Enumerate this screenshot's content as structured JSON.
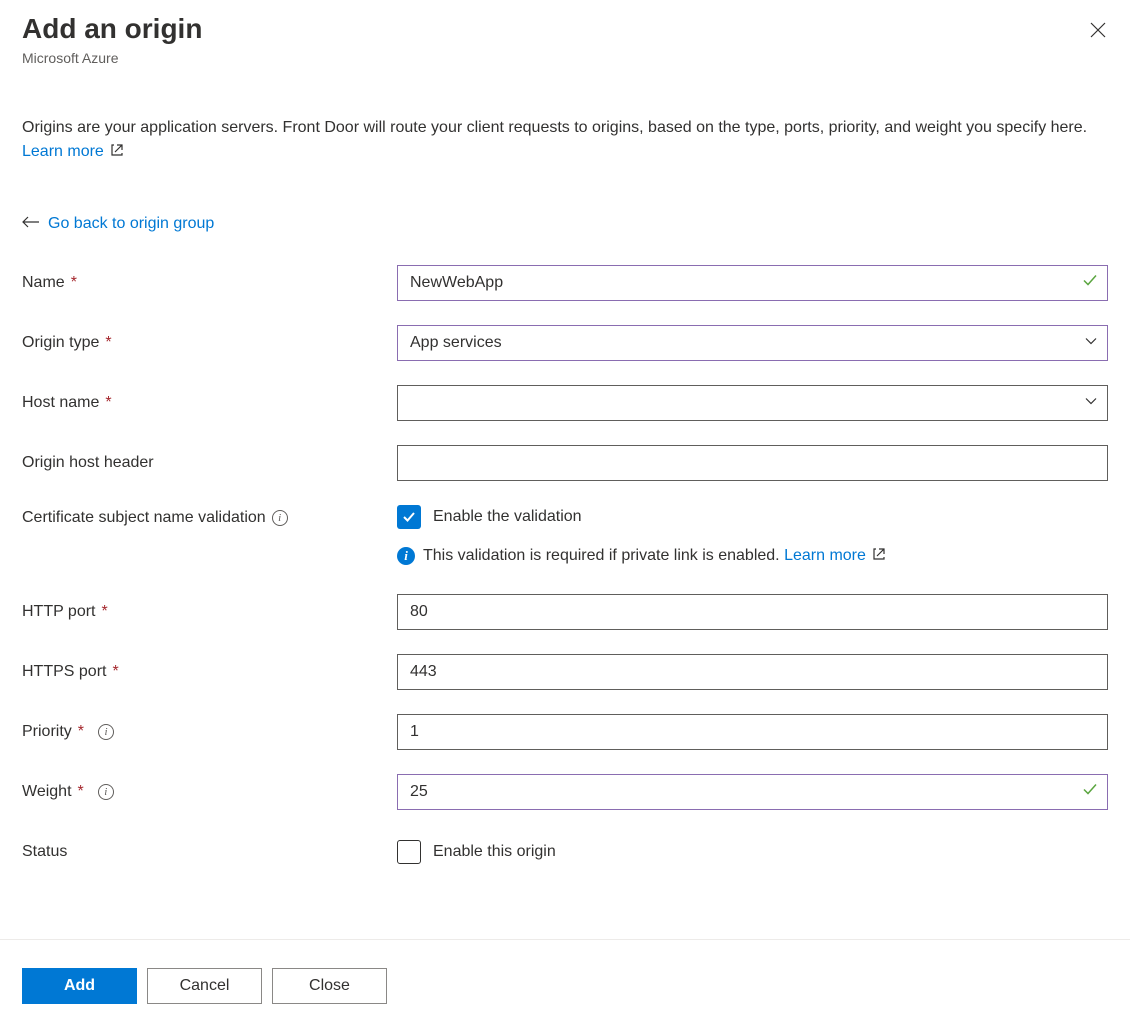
{
  "header": {
    "title": "Add an origin",
    "subtitle": "Microsoft Azure"
  },
  "description": {
    "text": "Origins are your application servers. Front Door will route your client requests to origins, based on the type, ports, priority, and weight you specify here.",
    "learn_more": "Learn more"
  },
  "back_link": "Go back to origin group",
  "fields": {
    "name": {
      "label": "Name",
      "value": "NewWebApp"
    },
    "origin_type": {
      "label": "Origin type",
      "value": "App services"
    },
    "host_name": {
      "label": "Host name",
      "value": ""
    },
    "origin_host_header": {
      "label": "Origin host header",
      "value": ""
    },
    "cert_validation": {
      "label": "Certificate subject name validation",
      "checkbox_label": "Enable the validation",
      "checked": true,
      "info_msg": "This validation is required if private link is enabled.",
      "info_link": "Learn more"
    },
    "http_port": {
      "label": "HTTP port",
      "value": "80"
    },
    "https_port": {
      "label": "HTTPS port",
      "value": "443"
    },
    "priority": {
      "label": "Priority",
      "value": "1"
    },
    "weight": {
      "label": "Weight",
      "value": "25"
    },
    "status": {
      "label": "Status",
      "checkbox_label": "Enable this origin",
      "checked": false
    }
  },
  "footer": {
    "add": "Add",
    "cancel": "Cancel",
    "close": "Close"
  }
}
